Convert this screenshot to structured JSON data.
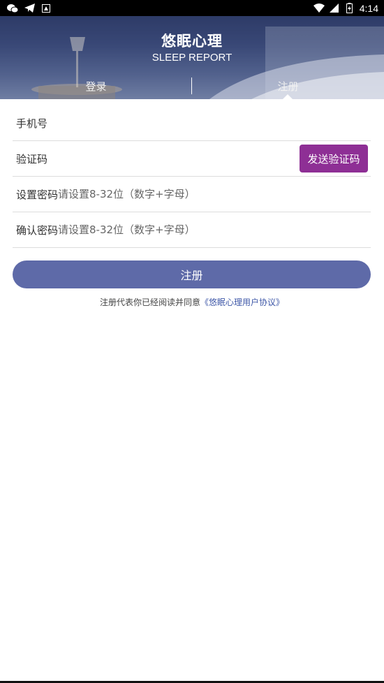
{
  "status_bar": {
    "time": "4:14",
    "left_icons": [
      "wechat-icon",
      "telegram-icon",
      "app-notification-icon"
    ],
    "right_icons": [
      "wifi-icon",
      "signal-icon",
      "battery-icon"
    ]
  },
  "header": {
    "title": "悠眠心理",
    "subtitle": "SLEEP REPORT",
    "tabs": [
      {
        "label": "登录"
      },
      {
        "label": "注册"
      }
    ]
  },
  "form": {
    "phone_label": "手机号",
    "code_label": "验证码",
    "send_code_label": "发送验证码",
    "password_label": "设置密码",
    "password_placeholder": "请设置8-32位（数字+字母）",
    "confirm_label": "确认密码",
    "confirm_placeholder": "请设置8-32位（数字+字母）"
  },
  "register_button": "注册",
  "agreement": {
    "text": "注册代表你已经阅读并同意",
    "link": "《悠眠心理用户协议》"
  },
  "colors": {
    "accent": "#8e2f95",
    "button": "#5e6aa8",
    "link": "#3f58a8"
  }
}
